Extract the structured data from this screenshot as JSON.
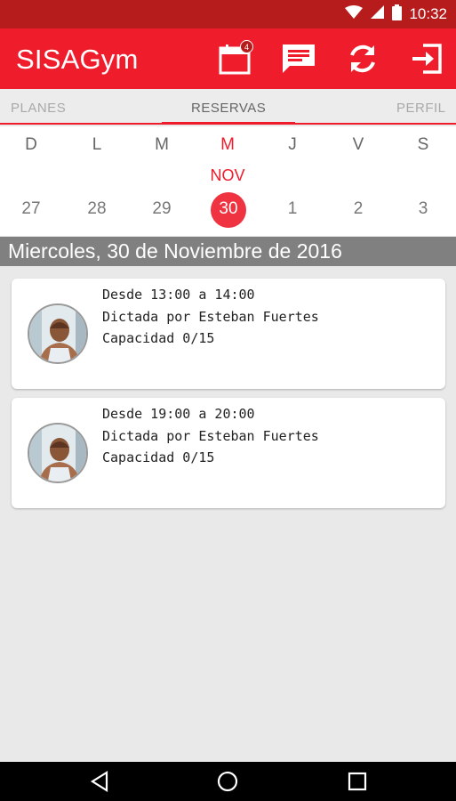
{
  "status_bar": {
    "time": "10:32",
    "icons": [
      "wifi-icon",
      "signal-icon",
      "battery-icon"
    ]
  },
  "app_bar": {
    "title": "SISAGym",
    "calendar_badge": "4",
    "actions": [
      "calendar-icon",
      "message-icon",
      "refresh-icon",
      "exit-icon"
    ]
  },
  "tabs": [
    {
      "label": "PLANES",
      "active": false
    },
    {
      "label": "RESERVAS",
      "active": true
    },
    {
      "label": "PERFIL",
      "active": false
    }
  ],
  "calendar": {
    "day_names": [
      "D",
      "L",
      "M",
      "M",
      "J",
      "V",
      "S"
    ],
    "month": "NOV",
    "days": [
      "27",
      "28",
      "29",
      "30",
      "1",
      "2",
      "3"
    ],
    "selected_index": 3
  },
  "date_header": "Miercoles, 30 de Noviembre de 2016",
  "classes": [
    {
      "time": "Desde 13:00 a 14:00",
      "instructor": "Dictada por Esteban Fuertes",
      "capacity": "Capacidad 0/15"
    },
    {
      "time": "Desde 19:00 a 20:00",
      "instructor": "Dictada por Esteban Fuertes",
      "capacity": "Capacidad 0/15"
    }
  ],
  "colors": {
    "primary": "#ef1c2b",
    "status_bar": "#b71c1c",
    "date_bar": "#808080"
  }
}
